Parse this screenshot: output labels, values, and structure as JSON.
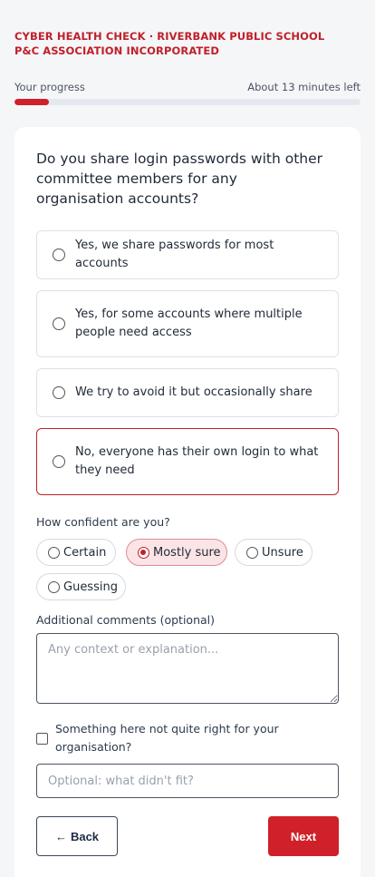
{
  "header": {
    "title": "CYBER HEALTH CHECK · RIVERBANK PUBLIC SCHOOL P&C ASSOCIATION INCORPORATED"
  },
  "progress": {
    "label": "Your progress",
    "time_left": "About 13 minutes left",
    "percent": 10
  },
  "question": {
    "text": "Do you share login passwords with other committee members for any organisation accounts?",
    "options": [
      {
        "label": "Yes, we share passwords for most accounts"
      },
      {
        "label": "Yes, for some accounts where multiple people need access"
      },
      {
        "label": "We try to avoid it but occasionally share"
      },
      {
        "label": "No, everyone has their own login to what they need"
      }
    ]
  },
  "confidence": {
    "label": "How confident are you?",
    "options": [
      "Certain",
      "Mostly sure",
      "Unsure",
      "Guessing"
    ],
    "selected": "Mostly sure"
  },
  "comments": {
    "label": "Additional comments (optional)",
    "placeholder": "Any context or explanation...",
    "value": ""
  },
  "not_fit": {
    "checkbox_label": "Something here not quite right for your organisation?",
    "placeholder": "Optional: what didn't fit?",
    "checked": false
  },
  "nav": {
    "back_arrow": "←",
    "back_label": "Back",
    "next_label": "Next"
  },
  "colors": {
    "accent": "#d0202a",
    "accent_light": "#fbe4e5",
    "progress_track": "#e5e9ef"
  }
}
